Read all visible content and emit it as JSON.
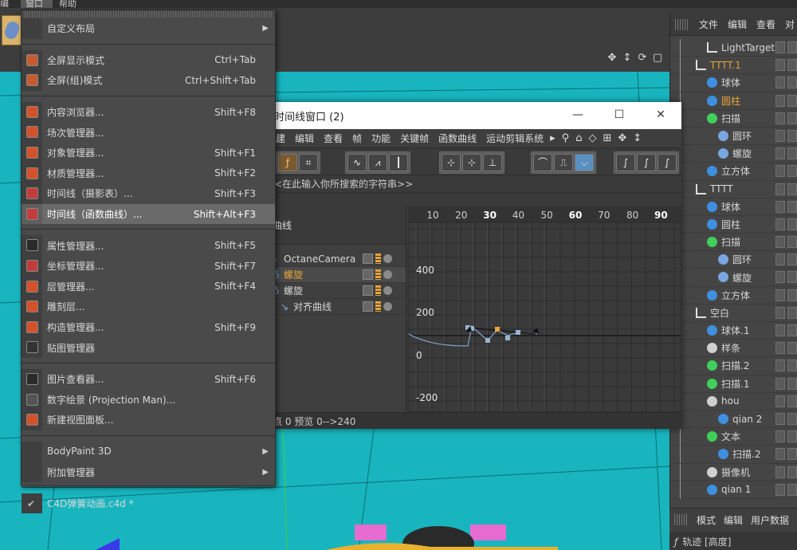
{
  "menubar": {
    "items": [
      "编",
      "窗口",
      "帮助"
    ]
  },
  "window_menu": {
    "items": [
      {
        "label": "自定义布局",
        "shortcut": "",
        "submenu": true,
        "icon": "none"
      },
      {
        "sep": true
      },
      {
        "label": "全屏显示模式",
        "shortcut": "Ctrl+Tab",
        "icon": "fullscreen-icon"
      },
      {
        "label": "全屏(组)模式",
        "shortcut": "Ctrl+Shift+Tab",
        "icon": "fullscreen-group-icon"
      },
      {
        "sep": true
      },
      {
        "label": "内容浏览器...",
        "shortcut": "Shift+F8",
        "icon": "content-browser-icon"
      },
      {
        "label": "场次管理器...",
        "shortcut": "",
        "icon": "take-manager-icon"
      },
      {
        "label": "对象管理器...",
        "shortcut": "Shift+F1",
        "icon": "object-manager-icon"
      },
      {
        "label": "材质管理器...",
        "shortcut": "Shift+F2",
        "icon": "material-manager-icon"
      },
      {
        "label": "时间线（摄影表）...",
        "shortcut": "Shift+F3",
        "icon": "timeline-dopesheet-icon"
      },
      {
        "label": "时间线（函数曲线）...",
        "shortcut": "Shift+Alt+F3",
        "icon": "timeline-fcurve-icon",
        "hover": true
      },
      {
        "sep": true
      },
      {
        "label": "属性管理器...",
        "shortcut": "Shift+F5",
        "icon": "attribute-manager-icon"
      },
      {
        "label": "坐标管理器...",
        "shortcut": "Shift+F7",
        "icon": "coordinate-manager-icon"
      },
      {
        "label": "层管理器...",
        "shortcut": "Shift+F4",
        "icon": "layer-manager-icon"
      },
      {
        "label": "雕刻层...",
        "shortcut": "",
        "icon": "sculpt-layer-icon"
      },
      {
        "label": "构造管理器...",
        "shortcut": "Shift+F9",
        "icon": "structure-manager-icon"
      },
      {
        "label": "贴图管理器",
        "shortcut": "",
        "icon": "texture-manager-icon"
      },
      {
        "sep": true
      },
      {
        "label": "图片查看器...",
        "shortcut": "Shift+F6",
        "icon": "picture-viewer-icon"
      },
      {
        "label": "数字绘景 (Projection Man)...",
        "shortcut": "",
        "icon": "projection-man-icon"
      },
      {
        "label": "新建视图面板...",
        "shortcut": "",
        "icon": "new-view-panel-icon"
      },
      {
        "sep": true
      },
      {
        "label": "BodyPaint 3D",
        "shortcut": "",
        "submenu": true,
        "icon": "none"
      },
      {
        "label": "附加管理器",
        "shortcut": "",
        "submenu": true,
        "icon": "none"
      },
      {
        "sep": true
      },
      {
        "label": "C4D弹簧动画.c4d *",
        "shortcut": "",
        "icon": "check",
        "checked": true
      }
    ]
  },
  "timeline": {
    "title": "时间线窗口 (2)",
    "menu": [
      "建",
      "编辑",
      "查看",
      "帧",
      "功能",
      "关键帧",
      "函数曲线",
      "运动剪辑系统"
    ],
    "search_placeholder": "<在此输入你所搜索的字符串>>",
    "header_label": "曲线",
    "tracks": [
      {
        "name": "OctaneCamera",
        "icon": "camera-icon",
        "selected": false
      },
      {
        "name": "螺旋",
        "icon": "helix-icon",
        "selected": true
      },
      {
        "name": "螺旋",
        "icon": "helix-icon",
        "selected": false
      },
      {
        "name": "对齐曲线",
        "icon": "align-curve-icon",
        "selected": false
      }
    ],
    "ruler": [
      "10",
      "20",
      "30",
      "40",
      "50",
      "60",
      "70",
      "80",
      "90"
    ],
    "y_labels": [
      "400",
      "200",
      "0",
      "-200"
    ],
    "status": "点 0 预览 0-->240"
  },
  "object_manager": {
    "menu": [
      "文件",
      "编辑",
      "查看",
      "对"
    ],
    "rows": [
      {
        "label": "LightTarget",
        "icon": "null-icon",
        "depth": 1
      },
      {
        "label": "TTTT.1",
        "icon": "null-icon",
        "depth": 0,
        "selected": true
      },
      {
        "label": "球体",
        "icon": "sphere-icon",
        "depth": 1
      },
      {
        "label": "圆柱",
        "icon": "cylinder-icon",
        "depth": 1,
        "selected": true
      },
      {
        "label": "扫描",
        "icon": "sweep-icon",
        "depth": 1
      },
      {
        "label": "圆环",
        "icon": "circle-icon",
        "depth": 2
      },
      {
        "label": "螺旋",
        "icon": "helix-icon",
        "depth": 2
      },
      {
        "label": "立方体",
        "icon": "cube-icon",
        "depth": 1
      },
      {
        "label": "TTTT",
        "icon": "null-icon",
        "depth": 0
      },
      {
        "label": "球体",
        "icon": "sphere-icon",
        "depth": 1
      },
      {
        "label": "圆柱",
        "icon": "cylinder-icon",
        "depth": 1
      },
      {
        "label": "扫描",
        "icon": "sweep-icon",
        "depth": 1
      },
      {
        "label": "圆环",
        "icon": "circle-icon",
        "depth": 2
      },
      {
        "label": "螺旋",
        "icon": "helix-icon",
        "depth": 2
      },
      {
        "label": "立方体",
        "icon": "cube-icon",
        "depth": 1
      },
      {
        "label": "空白",
        "icon": "null-icon",
        "depth": 0
      },
      {
        "label": "球体.1",
        "icon": "sphere-icon",
        "depth": 1
      },
      {
        "label": "样条",
        "icon": "spline-icon",
        "depth": 1
      },
      {
        "label": "扫描.2",
        "icon": "sweep-icon",
        "depth": 1
      },
      {
        "label": "扫描.1",
        "icon": "sweep-icon",
        "depth": 1
      },
      {
        "label": "hou",
        "icon": "object-icon",
        "depth": 1
      },
      {
        "label": "qian 2",
        "icon": "cylinder-icon",
        "depth": 2
      },
      {
        "label": "文本",
        "icon": "text-icon",
        "depth": 1
      },
      {
        "label": "扫描.2",
        "icon": "cylinder-icon",
        "depth": 2
      },
      {
        "label": "摄像机",
        "icon": "camera-icon",
        "depth": 1
      },
      {
        "label": "qian 1",
        "icon": "cylinder-icon",
        "depth": 1
      }
    ]
  },
  "attribute_manager": {
    "tabs": [
      "模式",
      "编辑",
      "用户数据"
    ],
    "track_label": "轨迹 [高度]"
  },
  "colors": {
    "viewport_bg": "#18b5bf",
    "accent_orange": "#e8a43a",
    "menu_bg": "#4a4a4a",
    "menu_hover": "#6a6a6a"
  }
}
